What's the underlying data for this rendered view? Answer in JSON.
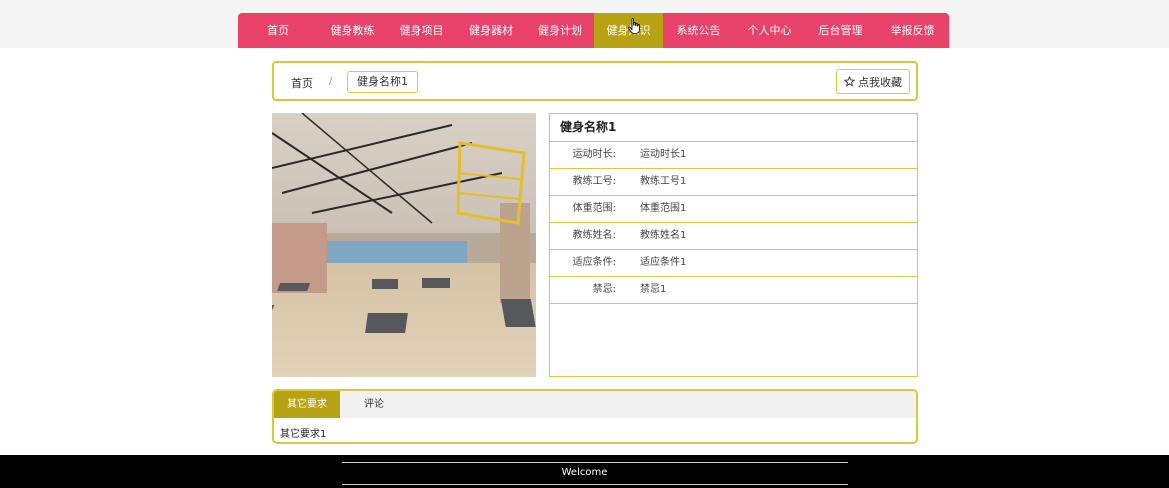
{
  "nav": {
    "items": [
      {
        "label": "首页",
        "active": false
      },
      {
        "label": "健身教练",
        "active": false
      },
      {
        "label": "健身项目",
        "active": false
      },
      {
        "label": "健身器材",
        "active": false
      },
      {
        "label": "健身计划",
        "active": false
      },
      {
        "label": "健身知识",
        "active": true
      },
      {
        "label": "系统公告",
        "active": false
      },
      {
        "label": "个人中心",
        "active": false
      },
      {
        "label": "后台管理",
        "active": false
      },
      {
        "label": "举报反馈",
        "active": false
      }
    ]
  },
  "breadcrumb": {
    "home": "首页",
    "separator": "/",
    "current": "健身名称1"
  },
  "favorite_button": {
    "label": "点我收藏",
    "icon": "star-outline-icon"
  },
  "detail": {
    "title": "健身名称1",
    "rows": [
      {
        "key": "运动时长:",
        "value": "运动时长1"
      },
      {
        "key": "教练工号:",
        "value": "教练工号1"
      },
      {
        "key": "体重范围:",
        "value": "体重范围1"
      },
      {
        "key": "教练姓名:",
        "value": "教练姓名1"
      },
      {
        "key": "适应条件:",
        "value": "适应条件1"
      },
      {
        "key": "禁忌:",
        "value": "禁忌1"
      }
    ]
  },
  "tabs": {
    "items": [
      {
        "label": "其它要求",
        "active": true
      },
      {
        "label": "评论",
        "active": false
      }
    ],
    "content": "其它要求1"
  },
  "footer": {
    "text": "Welcome"
  },
  "colors": {
    "nav_bg": "#e8416a",
    "accent": "#b7a213",
    "border": "#d8c93a",
    "footer_bg": "#000000"
  }
}
